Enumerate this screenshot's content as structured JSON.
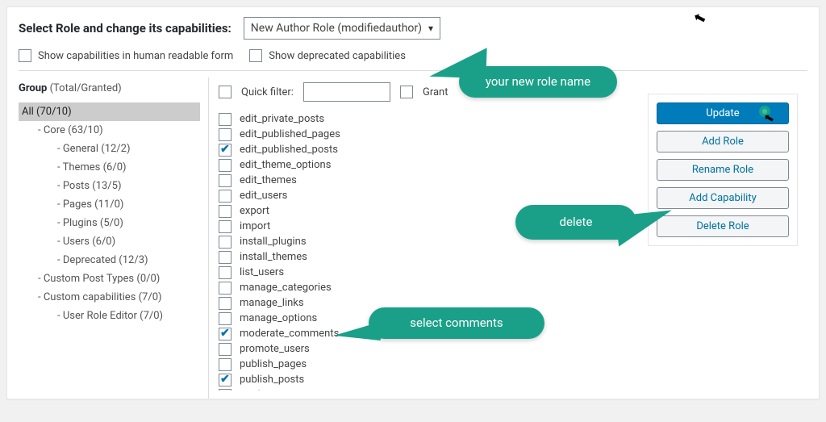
{
  "header": {
    "label": "Select Role and change its capabilities:",
    "selected_role": "New Author Role (modifiedauthor)"
  },
  "options": {
    "human_readable_label": "Show capabilities in human readable form",
    "deprecated_label": "Show deprecated capabilities"
  },
  "sidebar": {
    "group_label": "Group",
    "group_suffix": "(Total/Granted)",
    "items": [
      {
        "label": "All (70/10)",
        "indent": 0,
        "selected": true
      },
      {
        "label": "Core (63/10)",
        "indent": 1
      },
      {
        "label": "General (12/2)",
        "indent": 2
      },
      {
        "label": "Themes (6/0)",
        "indent": 2
      },
      {
        "label": "Posts (13/5)",
        "indent": 2
      },
      {
        "label": "Pages (11/0)",
        "indent": 2
      },
      {
        "label": "Plugins (5/0)",
        "indent": 2
      },
      {
        "label": "Users (6/0)",
        "indent": 2
      },
      {
        "label": "Deprecated (12/3)",
        "indent": 2
      },
      {
        "label": "Custom Post Types (0/0)",
        "indent": 1
      },
      {
        "label": "Custom capabilities (7/0)",
        "indent": 1
      },
      {
        "label": "User Role Editor (7/0)",
        "indent": 2
      }
    ]
  },
  "filter": {
    "label": "Quick filter:",
    "value": "",
    "granted_label": "Grant"
  },
  "capabilities": [
    {
      "name": "edit_private_posts",
      "checked": false
    },
    {
      "name": "edit_published_pages",
      "checked": false
    },
    {
      "name": "edit_published_posts",
      "checked": true
    },
    {
      "name": "edit_theme_options",
      "checked": false
    },
    {
      "name": "edit_themes",
      "checked": false
    },
    {
      "name": "edit_users",
      "checked": false
    },
    {
      "name": "export",
      "checked": false
    },
    {
      "name": "import",
      "checked": false
    },
    {
      "name": "install_plugins",
      "checked": false
    },
    {
      "name": "install_themes",
      "checked": false
    },
    {
      "name": "list_users",
      "checked": false
    },
    {
      "name": "manage_categories",
      "checked": false
    },
    {
      "name": "manage_links",
      "checked": false
    },
    {
      "name": "manage_options",
      "checked": false
    },
    {
      "name": "moderate_comments",
      "checked": true
    },
    {
      "name": "promote_users",
      "checked": false
    },
    {
      "name": "publish_pages",
      "checked": false
    },
    {
      "name": "publish_posts",
      "checked": true
    },
    {
      "name": "read",
      "checked": true
    }
  ],
  "actions": {
    "update": "Update",
    "add_role": "Add Role",
    "rename_role": "Rename Role",
    "add_capability": "Add Capability",
    "delete_role": "Delete Role"
  },
  "callouts": {
    "role": "your new role name",
    "delete": "delete",
    "select": "select comments"
  }
}
